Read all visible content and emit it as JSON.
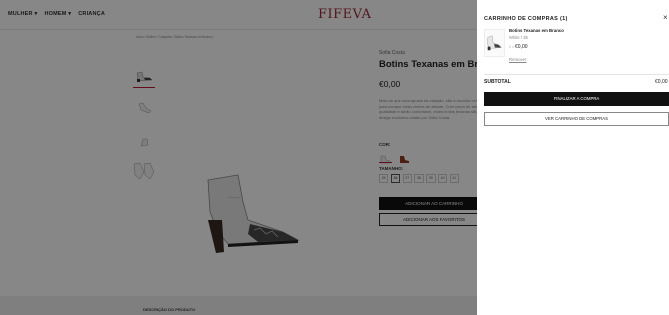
{
  "header": {
    "nav": [
      "MULHER",
      "HOMEM",
      "CRIANÇA"
    ],
    "logo": "FIFEVA"
  },
  "breadcrumb": "Início / Mulher / Calçados / Botins Texanas em Branco",
  "product": {
    "brand": "Sofia Costa",
    "title": "Botins Texanas em Branco",
    "price": "€0,00",
    "description": "Mais do que uma aposta da estação, são a escolha certa para compor looks cheios de atitude. Com couro de alta qualidade e tacão confortável, estes botins texanas são um design exclusivo criado por Sofia Costa.",
    "color_label": "COR:",
    "size_label": "TAMANHO:",
    "sizes": [
      "35",
      "36",
      "37",
      "38",
      "39",
      "40",
      "41"
    ],
    "add_to_cart": "ADICIONAR AO CARRINHO",
    "add_to_favorites": "ADICIONAR AOS FAVORITOS"
  },
  "bottom_tab": "DESCRIÇÃO DO PRODUTO",
  "cart": {
    "title": "CARRINHO DE COMPRAS (1)",
    "close": "×",
    "item": {
      "name": "Botins Texanas em Branco",
      "variant": "White / 35",
      "qty": "1 ×",
      "price": "€0,00",
      "remove": "Remover"
    },
    "subtotal_label": "SUBTOTAL",
    "subtotal_value": "€0,00",
    "checkout": "FINALIZAR A COMPRA",
    "view_cart": "VER CARRINHO DE COMPRAS"
  },
  "colors": {
    "accent": "#b31d2d",
    "logo": "#a0293b",
    "button_dark": "#111111",
    "overlay": "rgba(0,0,0,0.47)"
  }
}
